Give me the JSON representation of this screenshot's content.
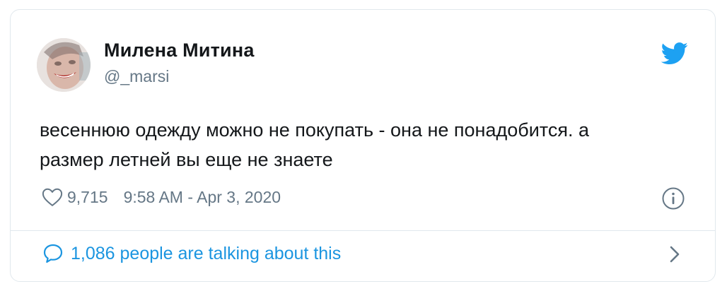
{
  "tweet": {
    "author_name": "Милена Митина",
    "author_handle": "@_marsi",
    "text": "весеннюю одежду можно не покупать - она не понадобится. а размер летней вы еще не знаете",
    "likes": "9,715",
    "timestamp": "9:58 AM - Apr 3, 2020",
    "conversation_label": "1,086 people are talking about this"
  },
  "colors": {
    "brand": "#1da1f2",
    "link": "#1b95e0",
    "muted": "#657786",
    "text": "#14171a",
    "border": "#e1e8ed"
  },
  "icons": {
    "brand": "twitter-bird-icon",
    "like": "heart-icon",
    "info": "info-icon",
    "reply": "speech-bubble-icon",
    "more": "chevron-right-icon"
  }
}
